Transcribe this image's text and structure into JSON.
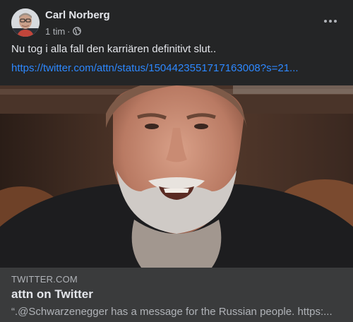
{
  "post": {
    "author": "Carl Norberg",
    "timestamp": "1 tim",
    "separator": "·",
    "audience_icon": "globe-icon",
    "text": "Nu tog i alla fall den karriären definitivt slut..",
    "link": "https://twitter.com/attn/status/1504423551717163008?s=21..."
  },
  "link_preview": {
    "domain": "TWITTER.COM",
    "title": "attn on Twitter",
    "description": "“.@Schwarzenegger has a message for the Russian people. https:..."
  },
  "colors": {
    "background": "#242526",
    "card_footer": "#3a3b3c",
    "link": "#2d88ff",
    "primary_text": "#e4e6eb",
    "secondary_text": "#b0b3b8"
  }
}
